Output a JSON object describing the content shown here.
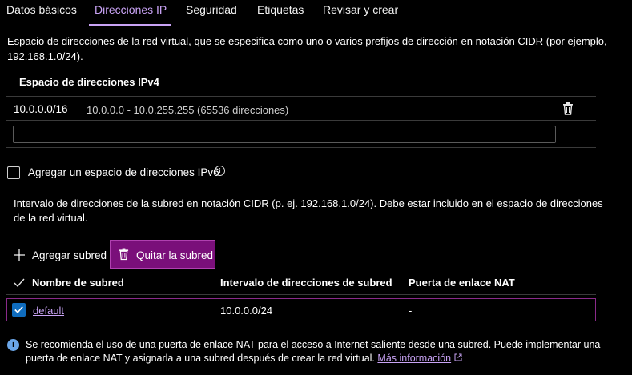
{
  "tabs": [
    {
      "label": "Datos básicos",
      "active": false
    },
    {
      "label": "Direcciones IP",
      "active": true
    },
    {
      "label": "Seguridad",
      "active": false
    },
    {
      "label": "Etiquetas",
      "active": false
    },
    {
      "label": "Revisar y crear",
      "active": false
    }
  ],
  "description": "Espacio de direcciones de la red virtual, que se especifica como uno o varios prefijos de dirección en notación CIDR (por ejemplo, 192.168.1.0/24).",
  "address_space": {
    "header": "Espacio de direcciones IPv4",
    "entries": [
      {
        "cidr": "10.0.0.0/16",
        "range": "10.0.0.0 - 10.0.255.255 (65536 direcciones)"
      }
    ],
    "new_value": ""
  },
  "ipv6": {
    "label": "Agregar un espacio de direcciones IPv6",
    "checked": false,
    "info_glyph": "i"
  },
  "subnet_description": "Intervalo de direcciones de la subred en notación CIDR (p. ej. 192.168.1.0/24). Debe estar incluido en el espacio de direcciones de la red virtual.",
  "toolbar": {
    "add_label": "Agregar subred",
    "remove_label": "Quitar la subred"
  },
  "table": {
    "columns": [
      "Nombre de subred",
      "Intervalo de direcciones de subred",
      "Puerta de enlace NAT"
    ],
    "rows": [
      {
        "name": "default",
        "range": "10.0.0.0/24",
        "nat": "-",
        "selected": true
      }
    ]
  },
  "note": {
    "text": "Se recomienda el uso de una puerta de enlace NAT para el acceso a Internet saliente desde una subred. Puede implementar una puerta de enlace NAT y asignarla a una subred después de crear la red virtual.",
    "link": "Más información"
  },
  "colors": {
    "accent": "#c9a3f5",
    "remove_button_bg": "#7a0f7a",
    "row_border": "#8a2a8a",
    "checkbox_checked": "#0f6cbd",
    "info_icon": "#6ba6e8"
  }
}
